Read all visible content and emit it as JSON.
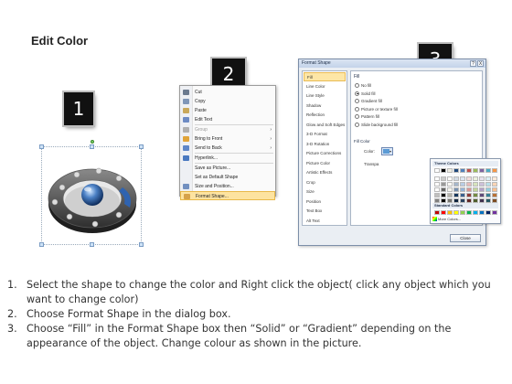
{
  "title": "Edit Color",
  "steps": [
    "1",
    "2",
    "3"
  ],
  "context_menu": {
    "items": [
      {
        "label": "Cut",
        "icon": "scissors-icon",
        "color": "#6b7a8f"
      },
      {
        "label": "Copy",
        "icon": "copy-icon",
        "color": "#7f96b8"
      },
      {
        "label": "Paste",
        "icon": "paste-icon",
        "color": "#c9a85a"
      },
      {
        "label": "Edit Text",
        "icon": "edit-text-icon",
        "color": "#6d8bc4"
      },
      {
        "label": "Group",
        "icon": "group-icon",
        "color": "#b0b0b0",
        "disabled": true,
        "submenu": true
      },
      {
        "label": "Bring to Front",
        "icon": "bring-front-icon",
        "color": "#e0a43a",
        "submenu": true
      },
      {
        "label": "Send to Back",
        "icon": "send-back-icon",
        "color": "#5e86c8",
        "submenu": true
      },
      {
        "label": "Hyperlink...",
        "icon": "hyperlink-icon",
        "color": "#4a79c0"
      },
      {
        "label": "Save as Picture...",
        "icon": "",
        "color": ""
      },
      {
        "label": "Set as Default Shape",
        "icon": "",
        "color": ""
      },
      {
        "label": "Size and Position...",
        "icon": "size-position-icon",
        "color": "#7290c0"
      },
      {
        "label": "Format Shape...",
        "icon": "format-shape-icon",
        "color": "#d6a24a",
        "highlighted": true
      }
    ]
  },
  "dialog": {
    "title": "Format Shape",
    "help": "?",
    "close_x": "X",
    "nav": [
      "Fill",
      "Line Color",
      "Line Style",
      "Shadow",
      "Reflection",
      "Glow and Soft Edges",
      "3-D Format",
      "3-D Rotation",
      "Picture Corrections",
      "Picture Color",
      "Artistic Effects",
      "Crop",
      "Size",
      "Position",
      "Text Box",
      "Alt Text"
    ],
    "selected_nav": "Fill",
    "fill_heading": "Fill",
    "options": [
      {
        "label": "No fill",
        "checked": false
      },
      {
        "label": "Solid fill",
        "checked": true
      },
      {
        "label": "Gradient fill",
        "checked": false
      },
      {
        "label": "Picture or texture fill",
        "checked": false
      },
      {
        "label": "Pattern fill",
        "checked": false
      },
      {
        "label": "Slide background fill",
        "checked": false
      }
    ],
    "fill_color_heading": "Fill Color",
    "color_label": "Color:",
    "transparency_label": "Transpa",
    "current_color": "#5b9bd5",
    "theme_colors_label": "Theme Colors",
    "standard_colors_label": "Standard Colors",
    "more_colors_label": "More Colors...",
    "theme_colors": [
      "#ffffff",
      "#000000",
      "#eeece1",
      "#1f497d",
      "#4f81bd",
      "#c0504d",
      "#9bbb59",
      "#8064a2",
      "#4bacc6",
      "#f79646"
    ],
    "standard_colors": [
      "#c00000",
      "#ff0000",
      "#ffc000",
      "#ffff00",
      "#92d050",
      "#00b050",
      "#00b0f0",
      "#0070c0",
      "#002060",
      "#7030a0"
    ],
    "close_label": "Close"
  },
  "instructions": [
    {
      "num": "1.",
      "text": "Select the shape to change the color and Right click the object( click any object which you want to change color)"
    },
    {
      "num": "2.",
      "text": "Choose Format Shape in the dialog box."
    },
    {
      "num": "3.",
      "text": "Choose “Fill” in the Format Shape box then “Solid” or “Gradient” depending on the appearance of the object. Change colour as shown in the picture."
    }
  ]
}
